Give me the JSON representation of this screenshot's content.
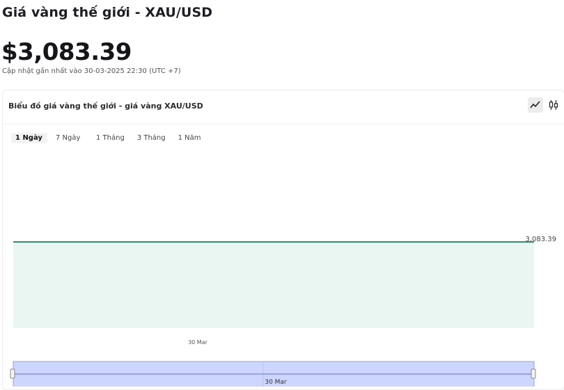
{
  "header": {
    "title": "Giá vàng thế giới - XAU/USD",
    "price": "$3,083.39",
    "updated": "Cập nhật gần nhất vào 30-03-2025 22:30 (UTC +7)"
  },
  "card": {
    "title": "Biểu đồ giá vàng thế giới - giá vàng XAU/USD",
    "chart_type_buttons": [
      {
        "icon": "line-chart-icon",
        "active": true
      },
      {
        "icon": "candlestick-chart-icon",
        "active": false
      }
    ]
  },
  "tabs": [
    {
      "label": "1 Ngày",
      "active": true
    },
    {
      "label": "7 Ngày",
      "active": false
    },
    {
      "label": "1 Tháng",
      "active": false
    },
    {
      "label": "3 Tháng",
      "active": false
    },
    {
      "label": "1 Năm",
      "active": false
    }
  ],
  "colors": {
    "line": "#2e8b70",
    "area": "#eaf6f1",
    "navigator_fill": "#cdd6ff",
    "navigator_border": "#8fa0e6"
  },
  "chart_data": {
    "type": "area",
    "series": [
      {
        "values": [
          3083.39,
          3083.39
        ]
      }
    ],
    "last_value_label": "3,083.39",
    "x_tick_labels": [
      "30 Mar"
    ],
    "navigator_label": "30 Mar"
  }
}
